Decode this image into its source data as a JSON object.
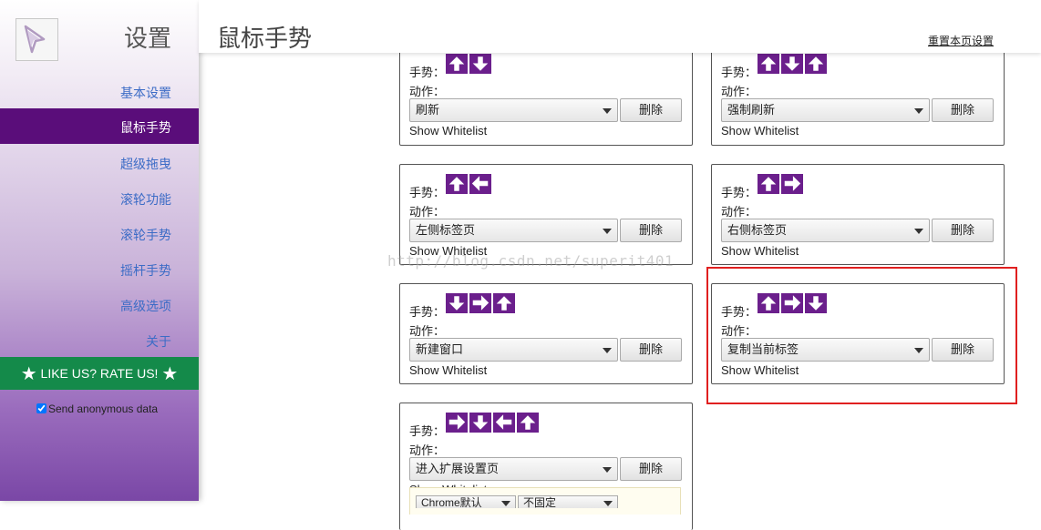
{
  "sidebar": {
    "title": "设置",
    "items": [
      {
        "label": "基本设置",
        "active": false
      },
      {
        "label": "鼠标手势",
        "active": true
      },
      {
        "label": "超级拖曳",
        "active": false
      },
      {
        "label": "滚轮功能",
        "active": false
      },
      {
        "label": "滚轮手势",
        "active": false
      },
      {
        "label": "摇杆手势",
        "active": false
      },
      {
        "label": "高级选项",
        "active": false
      },
      {
        "label": "关于",
        "active": false
      }
    ],
    "rate_label": "LIKE US? RATE US!",
    "anon_label": "Send anonymous data",
    "anon_checked": true
  },
  "header": {
    "title": "鼠标手势",
    "reset_link": "重置本页设置"
  },
  "common": {
    "gesture_label": "手势：",
    "action_label": "动作：",
    "delete_label": "删除",
    "whitelist_label": "Show Whitelist"
  },
  "gestures": [
    {
      "arrows": [
        "up",
        "down"
      ],
      "action": "刷新"
    },
    {
      "arrows": [
        "up",
        "down",
        "up"
      ],
      "action": "强制刷新"
    },
    {
      "arrows": [
        "up",
        "left"
      ],
      "action": "左侧标签页"
    },
    {
      "arrows": [
        "up",
        "right"
      ],
      "action": "右侧标签页"
    },
    {
      "arrows": [
        "down",
        "right",
        "up"
      ],
      "action": "新建窗口"
    },
    {
      "arrows": [
        "up",
        "right",
        "down"
      ],
      "action": "复制当前标签"
    },
    {
      "arrows": [
        "right",
        "down",
        "left",
        "up"
      ],
      "action": "进入扩展设置页",
      "extra_selects": [
        "Chrome默认",
        "不固定"
      ]
    }
  ],
  "watermark": "http://blog.csdn.net/superit401",
  "colors": {
    "arrow_bg": "#6b1f8c",
    "nav_active_bg": "#5a0d7a",
    "rate_bg": "#148a4a",
    "highlight": "#e02020"
  }
}
